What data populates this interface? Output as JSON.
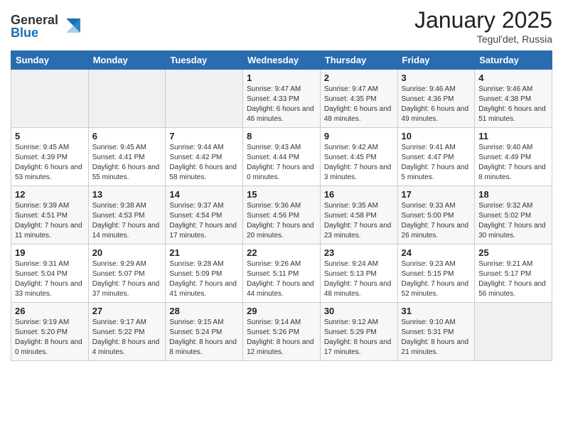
{
  "logo": {
    "line1": "General",
    "line2": "Blue"
  },
  "header": {
    "month": "January 2025",
    "location": "Tegul'det, Russia"
  },
  "weekdays": [
    "Sunday",
    "Monday",
    "Tuesday",
    "Wednesday",
    "Thursday",
    "Friday",
    "Saturday"
  ],
  "weeks": [
    [
      {
        "day": "",
        "info": ""
      },
      {
        "day": "",
        "info": ""
      },
      {
        "day": "",
        "info": ""
      },
      {
        "day": "1",
        "info": "Sunrise: 9:47 AM\nSunset: 4:33 PM\nDaylight: 6 hours and 46 minutes."
      },
      {
        "day": "2",
        "info": "Sunrise: 9:47 AM\nSunset: 4:35 PM\nDaylight: 6 hours and 48 minutes."
      },
      {
        "day": "3",
        "info": "Sunrise: 9:46 AM\nSunset: 4:36 PM\nDaylight: 6 hours and 49 minutes."
      },
      {
        "day": "4",
        "info": "Sunrise: 9:46 AM\nSunset: 4:38 PM\nDaylight: 6 hours and 51 minutes."
      }
    ],
    [
      {
        "day": "5",
        "info": "Sunrise: 9:45 AM\nSunset: 4:39 PM\nDaylight: 6 hours and 53 minutes."
      },
      {
        "day": "6",
        "info": "Sunrise: 9:45 AM\nSunset: 4:41 PM\nDaylight: 6 hours and 55 minutes."
      },
      {
        "day": "7",
        "info": "Sunrise: 9:44 AM\nSunset: 4:42 PM\nDaylight: 6 hours and 58 minutes."
      },
      {
        "day": "8",
        "info": "Sunrise: 9:43 AM\nSunset: 4:44 PM\nDaylight: 7 hours and 0 minutes."
      },
      {
        "day": "9",
        "info": "Sunrise: 9:42 AM\nSunset: 4:45 PM\nDaylight: 7 hours and 3 minutes."
      },
      {
        "day": "10",
        "info": "Sunrise: 9:41 AM\nSunset: 4:47 PM\nDaylight: 7 hours and 5 minutes."
      },
      {
        "day": "11",
        "info": "Sunrise: 9:40 AM\nSunset: 4:49 PM\nDaylight: 7 hours and 8 minutes."
      }
    ],
    [
      {
        "day": "12",
        "info": "Sunrise: 9:39 AM\nSunset: 4:51 PM\nDaylight: 7 hours and 11 minutes."
      },
      {
        "day": "13",
        "info": "Sunrise: 9:38 AM\nSunset: 4:53 PM\nDaylight: 7 hours and 14 minutes."
      },
      {
        "day": "14",
        "info": "Sunrise: 9:37 AM\nSunset: 4:54 PM\nDaylight: 7 hours and 17 minutes."
      },
      {
        "day": "15",
        "info": "Sunrise: 9:36 AM\nSunset: 4:56 PM\nDaylight: 7 hours and 20 minutes."
      },
      {
        "day": "16",
        "info": "Sunrise: 9:35 AM\nSunset: 4:58 PM\nDaylight: 7 hours and 23 minutes."
      },
      {
        "day": "17",
        "info": "Sunrise: 9:33 AM\nSunset: 5:00 PM\nDaylight: 7 hours and 26 minutes."
      },
      {
        "day": "18",
        "info": "Sunrise: 9:32 AM\nSunset: 5:02 PM\nDaylight: 7 hours and 30 minutes."
      }
    ],
    [
      {
        "day": "19",
        "info": "Sunrise: 9:31 AM\nSunset: 5:04 PM\nDaylight: 7 hours and 33 minutes."
      },
      {
        "day": "20",
        "info": "Sunrise: 9:29 AM\nSunset: 5:07 PM\nDaylight: 7 hours and 37 minutes."
      },
      {
        "day": "21",
        "info": "Sunrise: 9:28 AM\nSunset: 5:09 PM\nDaylight: 7 hours and 41 minutes."
      },
      {
        "day": "22",
        "info": "Sunrise: 9:26 AM\nSunset: 5:11 PM\nDaylight: 7 hours and 44 minutes."
      },
      {
        "day": "23",
        "info": "Sunrise: 9:24 AM\nSunset: 5:13 PM\nDaylight: 7 hours and 48 minutes."
      },
      {
        "day": "24",
        "info": "Sunrise: 9:23 AM\nSunset: 5:15 PM\nDaylight: 7 hours and 52 minutes."
      },
      {
        "day": "25",
        "info": "Sunrise: 9:21 AM\nSunset: 5:17 PM\nDaylight: 7 hours and 56 minutes."
      }
    ],
    [
      {
        "day": "26",
        "info": "Sunrise: 9:19 AM\nSunset: 5:20 PM\nDaylight: 8 hours and 0 minutes."
      },
      {
        "day": "27",
        "info": "Sunrise: 9:17 AM\nSunset: 5:22 PM\nDaylight: 8 hours and 4 minutes."
      },
      {
        "day": "28",
        "info": "Sunrise: 9:15 AM\nSunset: 5:24 PM\nDaylight: 8 hours and 8 minutes."
      },
      {
        "day": "29",
        "info": "Sunrise: 9:14 AM\nSunset: 5:26 PM\nDaylight: 8 hours and 12 minutes."
      },
      {
        "day": "30",
        "info": "Sunrise: 9:12 AM\nSunset: 5:29 PM\nDaylight: 8 hours and 17 minutes."
      },
      {
        "day": "31",
        "info": "Sunrise: 9:10 AM\nSunset: 5:31 PM\nDaylight: 8 hours and 21 minutes."
      },
      {
        "day": "",
        "info": ""
      }
    ]
  ]
}
